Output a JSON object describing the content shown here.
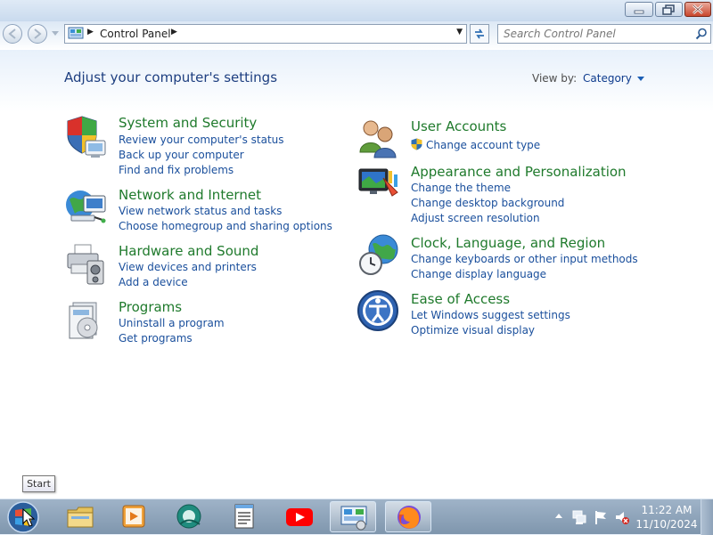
{
  "window": {
    "address": {
      "crumb": "Control Panel",
      "search_placeholder": "Search Control Panel"
    }
  },
  "content": {
    "title": "Adjust your computer's settings",
    "view_by": {
      "label": "View by:",
      "value": "Category"
    }
  },
  "categories": {
    "system_security": {
      "icon": "shield-icon",
      "title": "System and Security",
      "links": [
        "Review your computer's status",
        "Back up your computer",
        "Find and fix problems"
      ]
    },
    "network_internet": {
      "icon": "network-icon",
      "title": "Network and Internet",
      "links": [
        "View network status and tasks",
        "Choose homegroup and sharing options"
      ]
    },
    "hardware_sound": {
      "icon": "printer-icon",
      "title": "Hardware and Sound",
      "links": [
        "View devices and printers",
        "Add a device"
      ]
    },
    "programs": {
      "icon": "programs-icon",
      "title": "Programs",
      "links": [
        "Uninstall a program",
        "Get programs"
      ]
    },
    "user_accounts": {
      "icon": "users-icon",
      "title": "User Accounts",
      "links": [
        "Change account type"
      ]
    },
    "appearance": {
      "icon": "display-icon",
      "title": "Appearance and Personalization",
      "links": [
        "Change the theme",
        "Change desktop background",
        "Adjust screen resolution"
      ]
    },
    "clock_region": {
      "icon": "globe-clock-icon",
      "title": "Clock, Language, and Region",
      "links": [
        "Change keyboards or other input methods",
        "Change display language"
      ]
    },
    "ease_access": {
      "icon": "ease-of-access-icon",
      "title": "Ease of Access",
      "links": [
        "Let Windows suggest settings",
        "Optimize visual display"
      ]
    }
  },
  "taskbar": {
    "tooltip": "Start",
    "clock": {
      "time": "11:22 AM",
      "date": "11/10/2024"
    },
    "apps": [
      "file-explorer-icon",
      "media-player-icon",
      "app-icon",
      "notepad-icon",
      "youtube-icon",
      "control-panel-icon",
      "firefox-icon"
    ]
  },
  "colors": {
    "accent_link": "#1a4f9c",
    "category_title": "#1f7a2c",
    "heading": "#1e3f80"
  }
}
